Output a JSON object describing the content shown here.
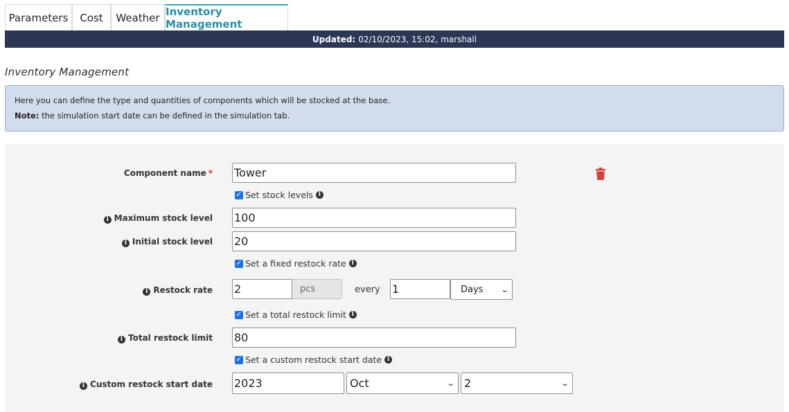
{
  "tabs": [
    {
      "label": "Parameters"
    },
    {
      "label": "Cost"
    },
    {
      "label": "Weather"
    },
    {
      "label": "Inventory Management",
      "active": true
    }
  ],
  "updated": {
    "label": "Updated:",
    "value": "02/10/2023, 15:02, marshall"
  },
  "section_title": "Inventory Management",
  "info": {
    "line1": "Here you can define the type and quantities of components which will be stocked at the base.",
    "note_label": "Note:",
    "note_text": "the simulation start date can be defined in the simulation tab."
  },
  "form": {
    "component_name": {
      "label": "Component name",
      "required_mark": "*",
      "value": "Tower"
    },
    "set_stock_levels": {
      "label": "Set stock levels",
      "checked": true
    },
    "max_stock": {
      "label": "Maximum stock level",
      "value": "100"
    },
    "initial_stock": {
      "label": "Initial stock level",
      "value": "20"
    },
    "fixed_restock": {
      "label": "Set a fixed restock rate",
      "checked": true
    },
    "restock_rate": {
      "label": "Restock rate",
      "value": "2",
      "unit": "pcs",
      "every_label": "every",
      "interval_value": "1",
      "interval_unit": "Days"
    },
    "total_limit_check": {
      "label": "Set a total restock limit",
      "checked": true
    },
    "total_limit": {
      "label": "Total restock limit",
      "value": "80"
    },
    "custom_start_check": {
      "label": "Set a custom restock start date",
      "checked": true
    },
    "custom_start": {
      "label": "Custom restock start date",
      "year": "2023",
      "month": "Oct",
      "day": "2"
    }
  },
  "icons": {
    "delete": "trash-icon",
    "info": "info-circle-icon",
    "check": "checkmark-icon",
    "dropdown": "chevron-down-icon"
  },
  "colors": {
    "nav_bar": "#2c3756",
    "active_tab": "#2a8da6",
    "info_box": "#d3dcec",
    "delete": "#d0413a",
    "required": "#d9342b"
  }
}
